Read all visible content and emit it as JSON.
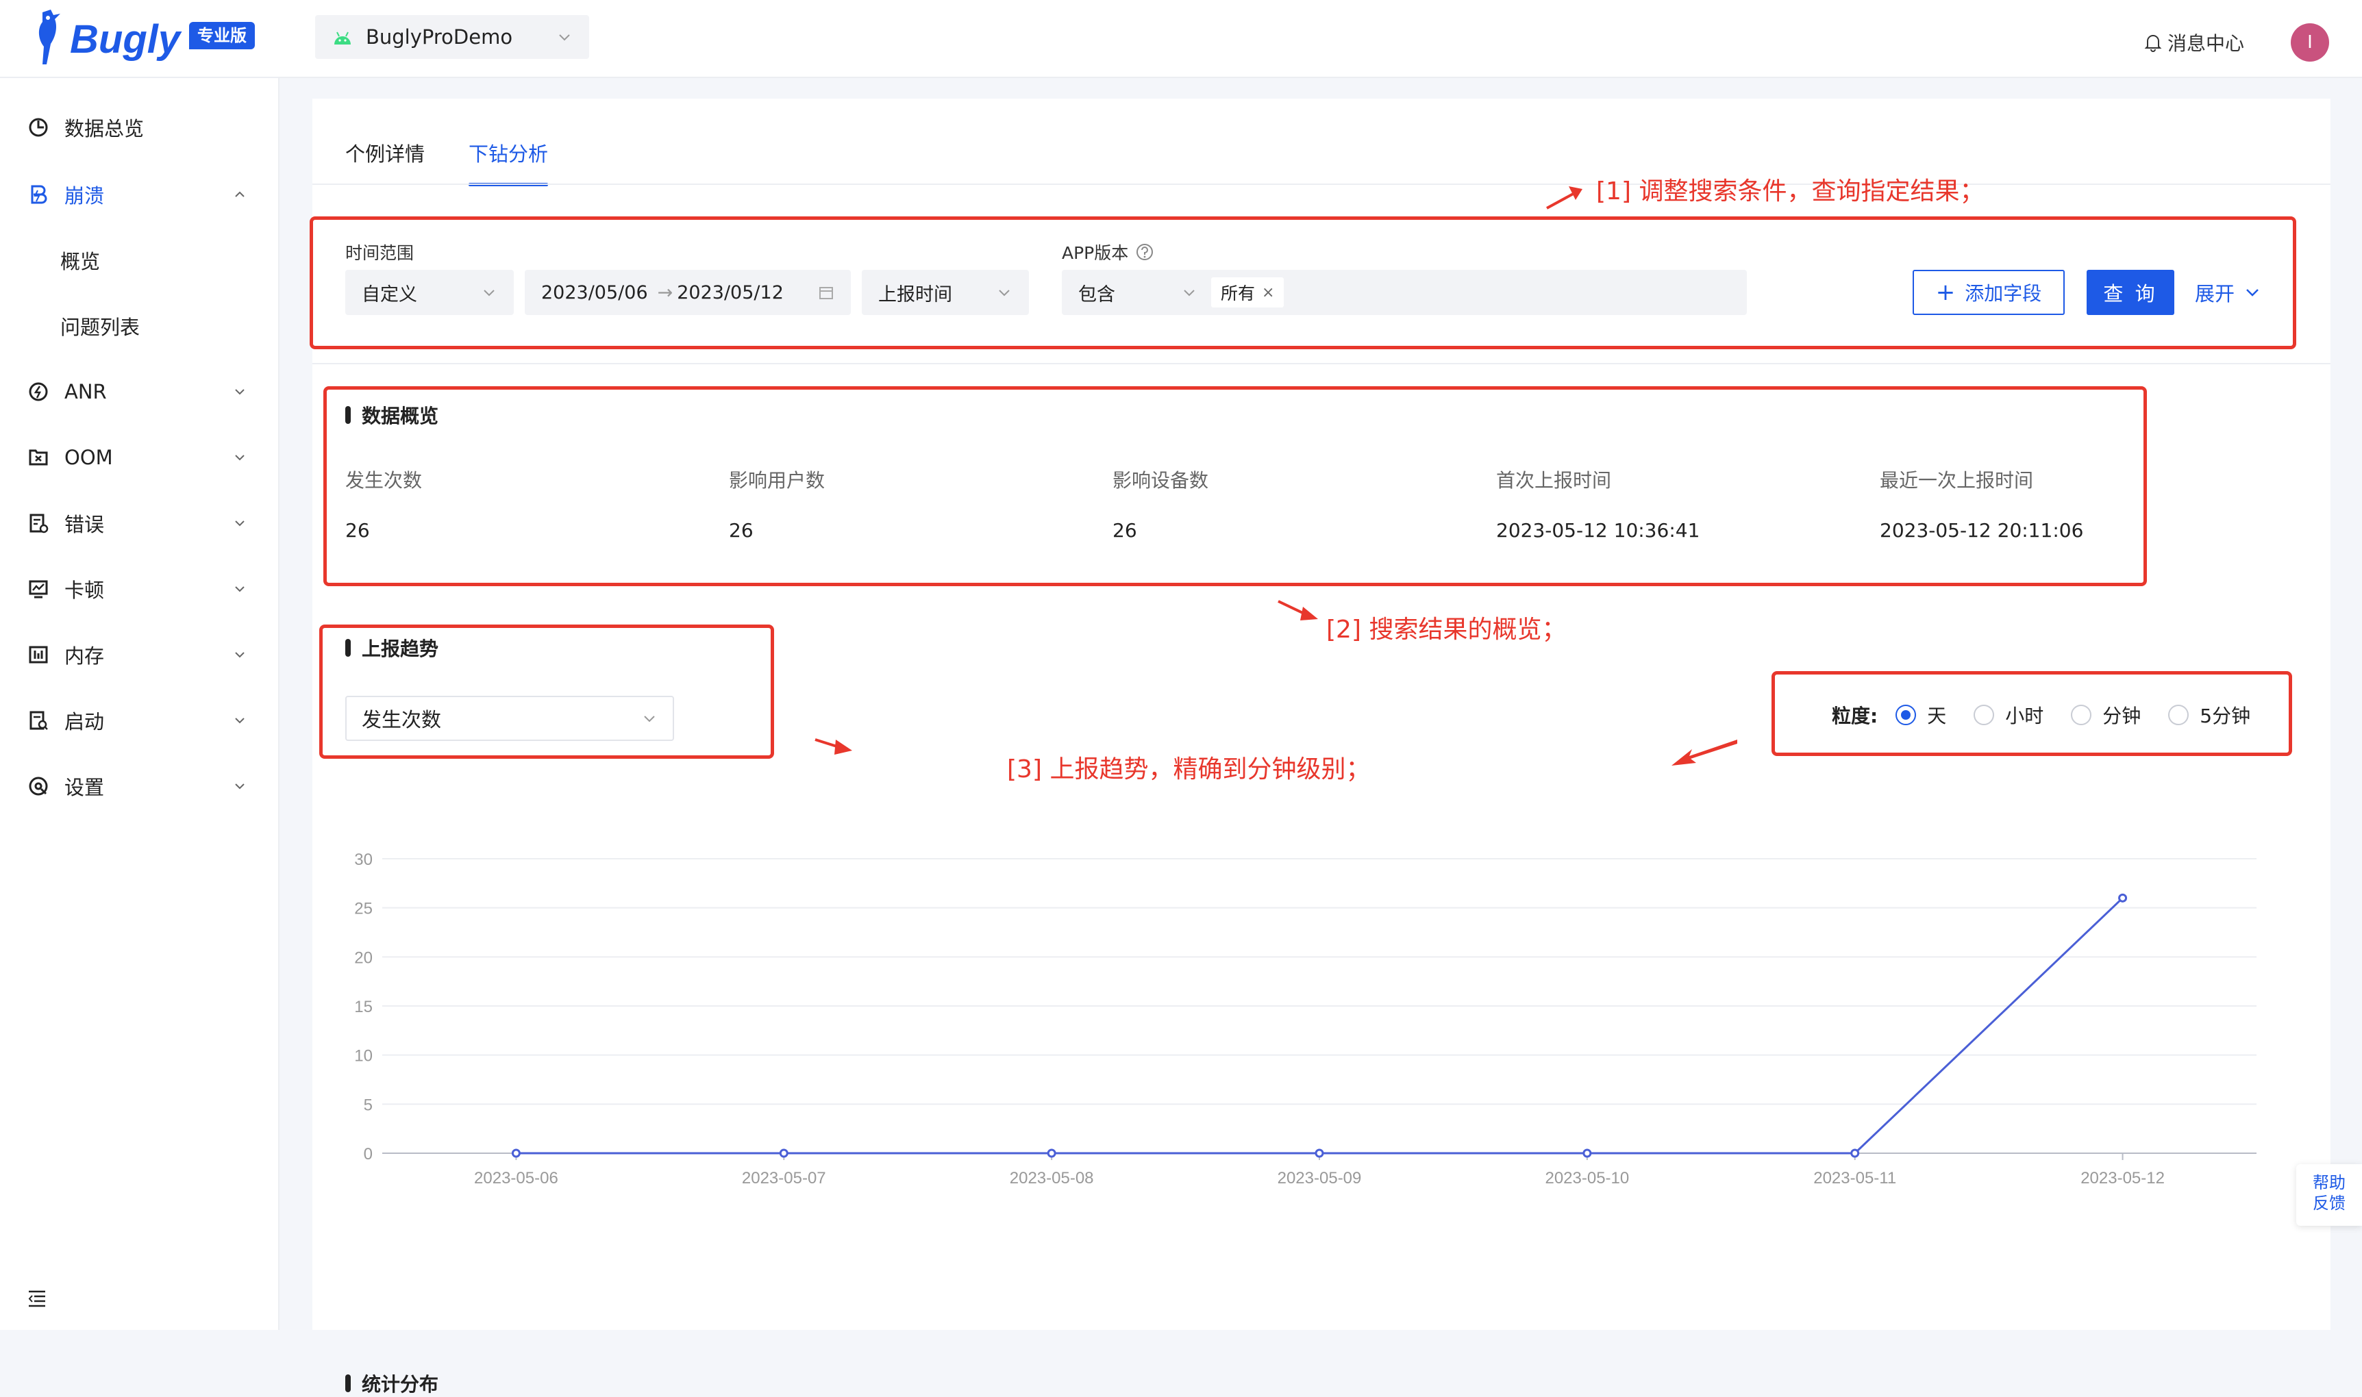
{
  "header": {
    "logo_text": "Bugly",
    "logo_badge": "专业版",
    "app_name": "BuglyProDemo",
    "message_center": "消息中心",
    "avatar_initial": "I",
    "brand_color": "#1e5ae6"
  },
  "sidebar": {
    "items": [
      {
        "label": "数据总览",
        "icon": "pie-chart-icon"
      },
      {
        "label": "崩溃",
        "icon": "crash-icon"
      },
      {
        "label": "概览"
      },
      {
        "label": "问题列表"
      },
      {
        "label": "ANR",
        "icon": "anr-icon"
      },
      {
        "label": "OOM",
        "icon": "oom-icon"
      },
      {
        "label": "错误",
        "icon": "error-icon"
      },
      {
        "label": "卡顿",
        "icon": "lag-icon"
      },
      {
        "label": "内存",
        "icon": "memory-icon"
      },
      {
        "label": "启动",
        "icon": "launch-icon"
      },
      {
        "label": "设置",
        "icon": "settings-icon"
      }
    ]
  },
  "tabs": [
    "个例详情",
    "下钻分析"
  ],
  "filters": {
    "time_range_label": "时间范围",
    "time_mode": "自定义",
    "date_start": "2023/05/06",
    "date_end": "2023/05/12",
    "time_type": "上报时间",
    "app_version_label": "APP版本",
    "version_op": "包含",
    "version_tag": "所有",
    "tag_close": "×",
    "add_field": "添加字段",
    "query": "查 询",
    "expand": "展开"
  },
  "overview": {
    "title": "数据概览",
    "stats": [
      {
        "label": "发生次数",
        "value": "26"
      },
      {
        "label": "影响用户数",
        "value": "26"
      },
      {
        "label": "影响设备数",
        "value": "26"
      },
      {
        "label": "首次上报时间",
        "value": "2023-05-12 10:36:41"
      },
      {
        "label": "最近一次上报时间",
        "value": "2023-05-12 20:11:06"
      }
    ]
  },
  "trend": {
    "title": "上报趋势",
    "metric": "发生次数",
    "granularity_label": "粒度:",
    "granularity_options": [
      "天",
      "小时",
      "分钟",
      "5分钟"
    ],
    "granularity_selected": "天"
  },
  "distribution": {
    "title": "统计分布"
  },
  "annotations": {
    "note1": "[1] 调整搜索条件，查询指定结果；",
    "note2": "[2] 搜索结果的概览；",
    "note3": "[3] 上报趋势，精确到分钟级别；",
    "color": "#e8372c"
  },
  "help": {
    "line1": "帮助",
    "line2": "反馈"
  },
  "chart_data": {
    "type": "line",
    "categories": [
      "2023-05-06",
      "2023-05-07",
      "2023-05-08",
      "2023-05-09",
      "2023-05-10",
      "2023-05-11",
      "2023-05-12"
    ],
    "series": [
      {
        "values": [
          0,
          0,
          0,
          0,
          0,
          0,
          26
        ]
      }
    ],
    "ylim": [
      0,
      30
    ],
    "yticks": [
      0,
      5,
      10,
      15,
      20,
      25,
      30
    ],
    "grid": true,
    "line_color": "#4a5fd6"
  }
}
